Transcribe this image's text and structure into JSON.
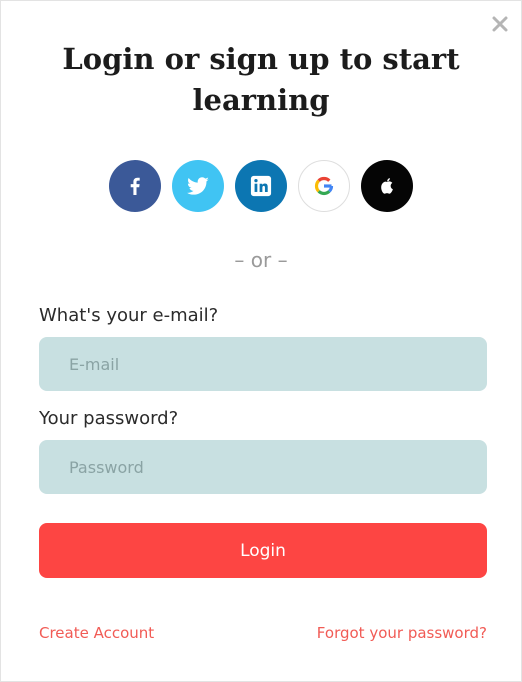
{
  "modal": {
    "title": "Login or sign up to start learning",
    "close_icon": "close-icon"
  },
  "social": {
    "items": [
      {
        "name": "facebook",
        "icon": "facebook-icon",
        "color": "#3b5998"
      },
      {
        "name": "twitter",
        "icon": "twitter-icon",
        "color": "#40c4f3"
      },
      {
        "name": "linkedin",
        "icon": "linkedin-icon",
        "color": "#0c76b2"
      },
      {
        "name": "google",
        "icon": "google-icon",
        "color": "#ffffff"
      },
      {
        "name": "apple",
        "icon": "apple-icon",
        "color": "#050505"
      }
    ]
  },
  "divider": {
    "text": "– or –"
  },
  "form": {
    "email_label": "What's your e-mail?",
    "email_placeholder": "E-mail",
    "email_value": "",
    "password_label": "Your password?",
    "password_placeholder": "Password",
    "password_value": "",
    "login_label": "Login"
  },
  "links": {
    "create_account": "Create Account",
    "forgot_password": "Forgot your password?"
  },
  "colors": {
    "accent": "#fd4543",
    "link": "#f15b55",
    "field_bg": "#c8e0e1"
  }
}
